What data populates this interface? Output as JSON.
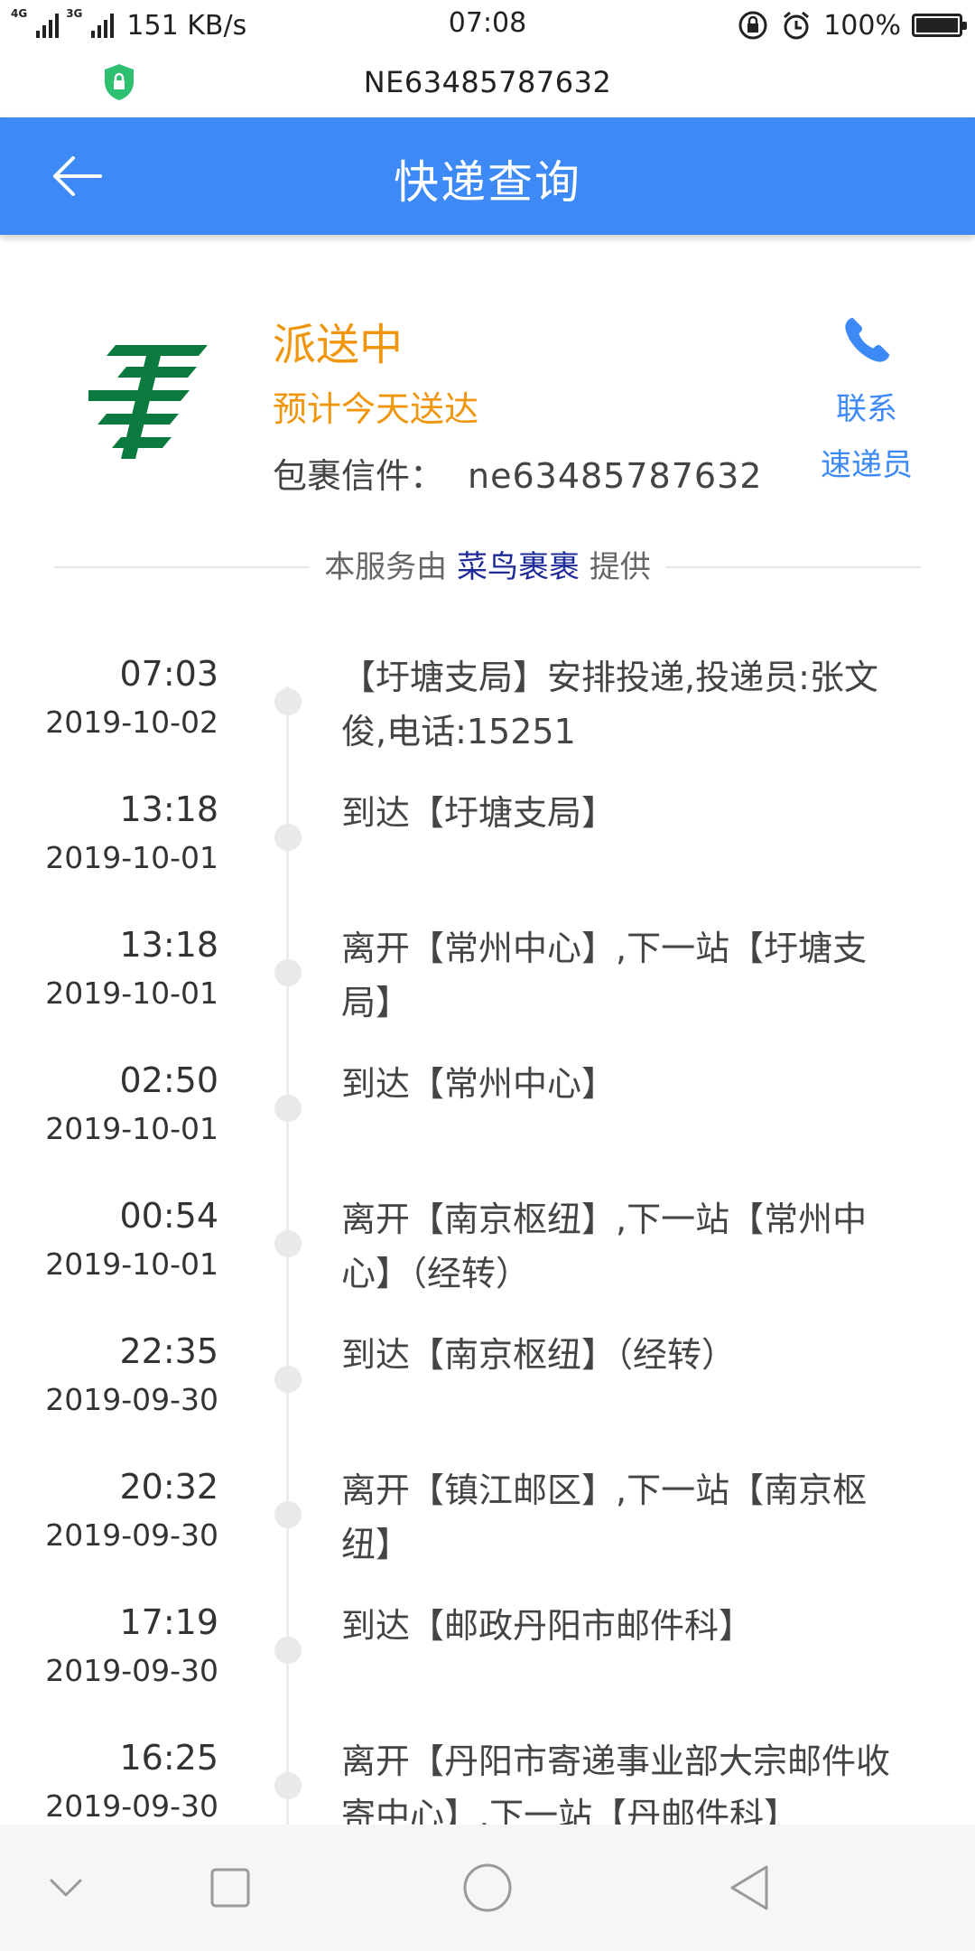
{
  "status_bar": {
    "network_tag_1": "4G",
    "network_tag_2": "3G",
    "speed": "151 KB/s",
    "time": "07:08",
    "battery": "100%"
  },
  "url_bar": {
    "url": "NE63485787632",
    "icon": "shield-lock-icon"
  },
  "header": {
    "title": "快递查询",
    "back_icon": "arrow-left-icon",
    "color": "#3d8af7"
  },
  "summary": {
    "status": "派送中",
    "estimate": "预计今天送达",
    "parcel_label": "包裹信件：",
    "parcel_number": "ne63485787632",
    "contact_line1": "联系",
    "contact_line2": "速递员",
    "status_color": "#f0960e",
    "logo_color": "#0a7a3e"
  },
  "provider": {
    "prefix": "本服务由",
    "brand": "菜鸟裹裹",
    "suffix": "提供"
  },
  "timeline": [
    {
      "time": "07:03",
      "date": "2019-10-02",
      "text": "【圩塘支局】安排投递,投递员:张文俊,电话:15251"
    },
    {
      "time": "13:18",
      "date": "2019-10-01",
      "text": "到达【圩塘支局】"
    },
    {
      "time": "13:18",
      "date": "2019-10-01",
      "text": "离开【常州中心】,下一站【圩塘支局】"
    },
    {
      "time": "02:50",
      "date": "2019-10-01",
      "text": "到达【常州中心】"
    },
    {
      "time": "00:54",
      "date": "2019-10-01",
      "text": "离开【南京枢纽】,下一站【常州中心】（经转）"
    },
    {
      "time": "22:35",
      "date": "2019-09-30",
      "text": "到达【南京枢纽】（经转）"
    },
    {
      "time": "20:32",
      "date": "2019-09-30",
      "text": "离开【镇江邮区】,下一站【南京枢纽】"
    },
    {
      "time": "17:19",
      "date": "2019-09-30",
      "text": "到达【邮政丹阳市邮件科】"
    },
    {
      "time": "16:25",
      "date": "2019-09-30",
      "text": "离开【丹阳市寄递事业部大宗邮件收寄中心】,下一站【丹邮件科】"
    }
  ],
  "nav": {
    "icons": [
      "chevron-down-icon",
      "square-icon",
      "circle-icon",
      "triangle-back-icon"
    ]
  }
}
